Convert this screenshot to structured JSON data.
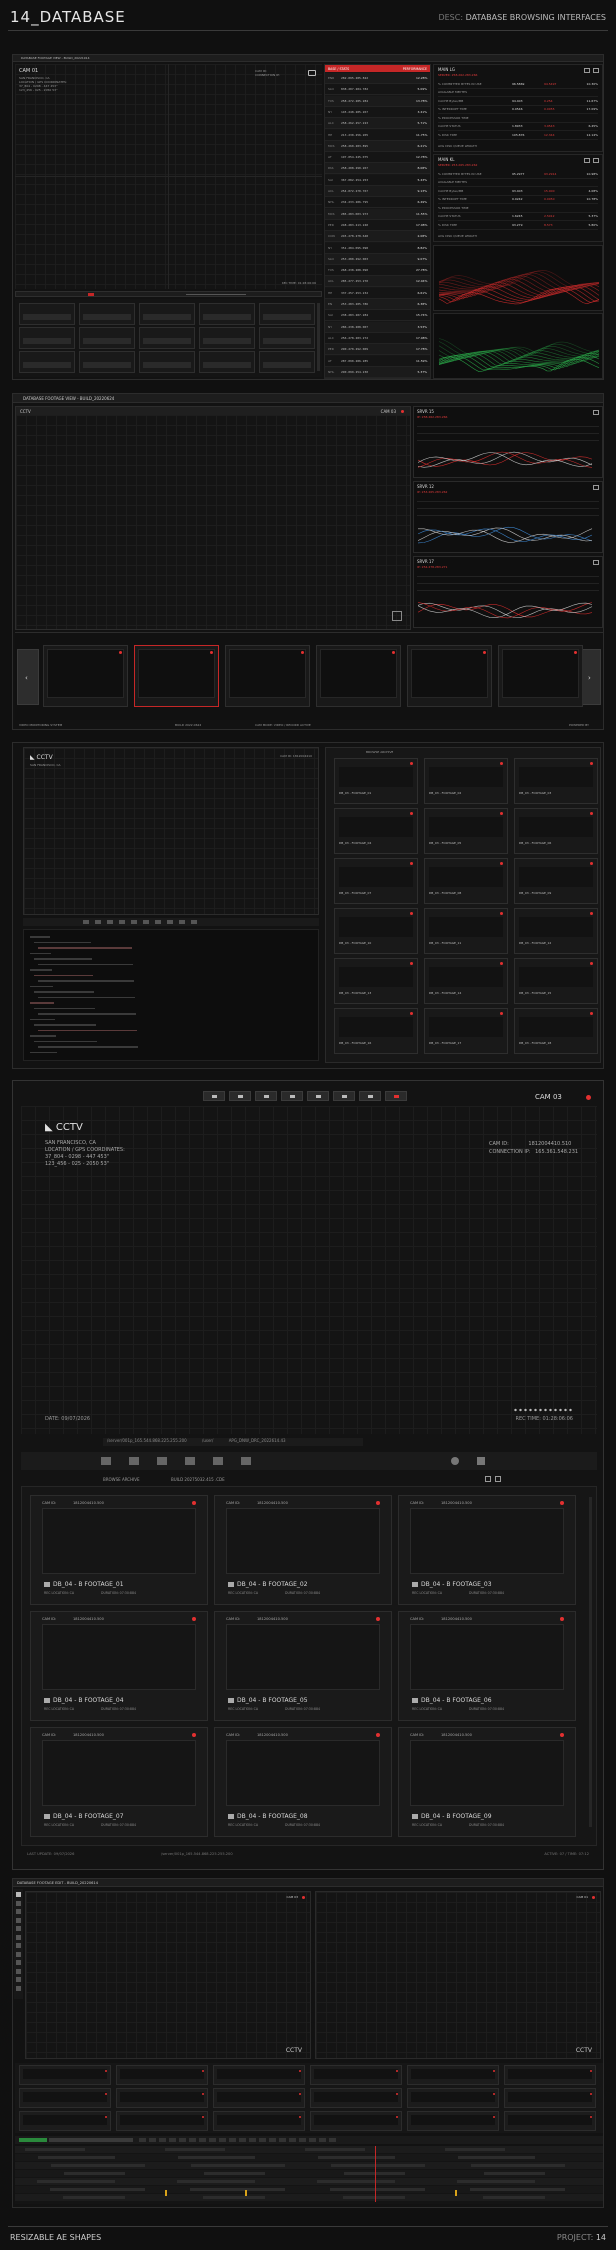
{
  "header": {
    "title": "14_DATABASE",
    "desc_label": "DESC:",
    "desc_value": "DATABASE BROWSING INTERFACES"
  },
  "footer": {
    "left": "RESIZABLE AE SHAPES",
    "right_label": "PROJECT:",
    "right_value": "14"
  },
  "section1": {
    "window_title": "DATABASE FOOTAGE VIEW - BUILD_20221914",
    "cam_label": "CAM 01",
    "loc_lines": [
      "SAN FRANCISCO, CA",
      "LOCATION / GPS COORDINATES:",
      "37_804 - 0298 - 447 453\"",
      "123_456 - 025 - 2050 53\""
    ],
    "info_right": [
      "CAM ID:",
      "CONNECTION IP:"
    ],
    "rec_time": "REC TIME: 01:28:06:06",
    "list_header": "BASE / STATS",
    "list_header_right": "PERFORMANCE",
    "rows": [
      {
        "tag": "ENR",
        "ip": "282.095.285.822",
        "pct": "12.28%"
      },
      {
        "tag": "SLO",
        "ip": "838.207.284.782",
        "pct": "5.09%"
      },
      {
        "tag": "TXS",
        "ip": "258.272.285.284",
        "pct": "13.78%"
      },
      {
        "tag": "NY",
        "ip": "145.248.285.267",
        "pct": "3.41%"
      },
      {
        "tag": "ALC",
        "ip": "258.262.257.223",
        "pct": "5.71%"
      },
      {
        "tag": "HE",
        "ip": "213.230.256.205",
        "pct": "11.75%"
      },
      {
        "tag": "MCS",
        "ip": "258.260.283.895",
        "pct": "6.21%"
      },
      {
        "tag": "AT",
        "ip": "197.054.245.075",
        "pct": "12.78%"
      },
      {
        "tag": "PAS",
        "ip": "258.208.290.267",
        "pct": "8.08%"
      },
      {
        "tag": "SAI",
        "ip": "367.082.254.253",
        "pct": "5.43%"
      },
      {
        "tag": "ACL",
        "ip": "254.072.270.767",
        "pct": "9.13%"
      },
      {
        "tag": "NHL",
        "ip": "234.233.286.795",
        "pct": "6.49%"
      },
      {
        "tag": "MCS",
        "ip": "285.283.003.973",
        "pct": "11.55%"
      },
      {
        "tag": "PER",
        "ip": "248.283.213.240",
        "pct": "17.08%"
      },
      {
        "tag": "CON",
        "ip": "245.278.278.648",
        "pct": "2.08%"
      },
      {
        "tag": "NY",
        "ip": "351.284.095.098",
        "pct": "8.82%"
      },
      {
        "tag": "SLO",
        "ip": "253.280.292.003",
        "pct": "9.07%"
      },
      {
        "tag": "TXS",
        "ip": "268.238.288.090",
        "pct": "27.78%"
      },
      {
        "tag": "ACL",
        "ip": "285.277.253.270",
        "pct": "12.04%"
      },
      {
        "tag": "HE",
        "ip": "337.257.253.232",
        "pct": "6.61%"
      },
      {
        "tag": "EN",
        "ip": "253.283.285.786",
        "pct": "6.38%"
      },
      {
        "tag": "SAI",
        "ip": "238.283.287.284",
        "pct": "15.74%"
      },
      {
        "tag": "NY",
        "ip": "286.238.288.007",
        "pct": "3.53%"
      },
      {
        "tag": "ALC",
        "ip": "256.278.283.272",
        "pct": "17.08%"
      },
      {
        "tag": "PER",
        "ip": "290.270.292.009",
        "pct": "17.78%"
      },
      {
        "tag": "AT",
        "ip": "287.090.286.285",
        "pct": "11.59%"
      },
      {
        "tag": "NHL",
        "ip": "290.099.254.230",
        "pct": "5.37%"
      }
    ],
    "stats_a": {
      "title": "MAIN LG",
      "subtitle": "SERVER: 258.262.283.266",
      "lines": [
        {
          "k": "% COMMITTED BYTES IN USE",
          "a": "96.5869",
          "b": "94.5497",
          "c": "10.30%"
        },
        {
          "k": "AVAILABLE MBYTES",
          "a": "",
          "b": "",
          "c": ""
        },
        {
          "k": "CACHE Bytes/MB",
          "a": "94.403",
          "b": "0.254",
          "c": "11.67%"
        },
        {
          "k": "% INTERRUPT TIME",
          "a": "0.0546",
          "b": "0.0055",
          "c": "17.09%"
        },
        {
          "k": "% PROCESSOR TIME",
          "a": "",
          "b": "",
          "c": ""
        },
        {
          "k": "CACHE STATUS",
          "a": "1.8933",
          "b": "3.9543",
          "c": "6.45%"
        },
        {
          "k": "% DISK TIME",
          "a": "105.876",
          "b": "12.344",
          "c": "12.14%"
        }
      ],
      "footer": "AVG DISK QUEUE LENGTH"
    },
    "stats_b": {
      "title": "MAIN KL",
      "subtitle": "SERVER: 253.265.283.262",
      "lines": [
        {
          "k": "% COMMITTED BYTES IN USE",
          "a": "95.2977",
          "b": "93.2914",
          "c": "10.98%"
        },
        {
          "k": "AVAILABLE MBYTES",
          "a": "",
          "b": "",
          "c": ""
        },
        {
          "k": "CACHE Bytes/MB",
          "a": "93.403",
          "b": "15.000",
          "c": "4.08%"
        },
        {
          "k": "% INTERRUPT TIME",
          "a": "0.0242",
          "b": "0.0050",
          "c": "10.78%"
        },
        {
          "k": "% PROCESSOR TIME",
          "a": "",
          "b": "",
          "c": ""
        },
        {
          "k": "CACHE STATUS",
          "a": "1.6245",
          "b": "2.5012",
          "c": "5.37%"
        },
        {
          "k": "% DISK TIME",
          "a": "93.279",
          "b": "8.573",
          "c": "5.80%"
        }
      ],
      "footer": "AVG DISK QUEUE LENGTH"
    }
  },
  "section2": {
    "window_title": "DATABASE FOOTAGE VIEW - BUILD_20220624",
    "cctv_label": "CCTV",
    "cam_label": "CAM 03",
    "servers": [
      {
        "title": "SRVR 15",
        "sub": "IP: 258.262.283.266"
      },
      {
        "title": "SRVR 12",
        "sub": "IP: 253.265.283.262"
      },
      {
        "title": "SRVR 17",
        "sub": "IP: 254.278.283.271"
      }
    ],
    "footer_items": [
      "VIDEO MONITORING SYSTEM",
      "BUILD 2022.0624",
      "CAM MODE: VIDEO / RECORD ACTIVE",
      "POWERED BY"
    ]
  },
  "section3": {
    "cctv_label": "CCTV",
    "loc": "SAN FRANCISCO, CA",
    "cam_id": "CAM ID: 1812004410",
    "browse_label": "BROWSE ARCHIVE",
    "tiles": [
      "DB_03 - FOOTAGE_01",
      "DB_03 - FOOTAGE_02",
      "DB_03 - FOOTAGE_03",
      "DB_03 - FOOTAGE_04",
      "DB_03 - FOOTAGE_05",
      "DB_03 - FOOTAGE_06",
      "DB_03 - FOOTAGE_07",
      "DB_03 - FOOTAGE_08",
      "DB_03 - FOOTAGE_09",
      "DB_03 - FOOTAGE_10",
      "DB_03 - FOOTAGE_11",
      "DB_03 - FOOTAGE_12",
      "DB_03 - FOOTAGE_13",
      "DB_03 - FOOTAGE_14",
      "DB_03 - FOOTAGE_15",
      "DB_03 - FOOTAGE_16",
      "DB_03 - FOOTAGE_17",
      "DB_03 - FOOTAGE_18"
    ]
  },
  "section4": {
    "cctv_label": "CCTV",
    "cam_label": "CAM 03",
    "city": "SAN FRANCISCO, CA",
    "gps_label": "LOCATION / GPS COORDINATES:",
    "gps_1": "37_804 - 0298 - 447 453\"",
    "gps_2": "123_456 - 025 - 2050 53\"",
    "cam_id_label": "CAM ID:",
    "cam_id_value": "1812004410.510",
    "conn_label": "CONNECTION IP:",
    "conn_value": "165.361.548.231",
    "date": "DATE: 09/07/2026",
    "rec_time": "REC TIME: 01:28:06:06",
    "path_1": "/server/001p_165.544.868.225.255.200",
    "path_2": "/user/",
    "path_3": "APG_DNW_DRC_2022614.43",
    "browse_label": "BROWSE ARCHIVE",
    "build_label": "BUILD 20275032.415 .CDE",
    "cards": [
      {
        "cam": "CAM ID:",
        "id": "1812004410.500",
        "title": "DB_04 - B FOOTAGE_01",
        "loc": "REC LOCATION: CA",
        "dur": "DURATION: 07:30:884"
      },
      {
        "cam": "CAM ID:",
        "id": "1812004410.500",
        "title": "DB_04 - B FOOTAGE_02",
        "loc": "REC LOCATION: CA",
        "dur": "DURATION: 07:30:884"
      },
      {
        "cam": "CAM ID:",
        "id": "1812004410.500",
        "title": "DB_04 - B FOOTAGE_03",
        "loc": "REC LOCATION: CA",
        "dur": "DURATION: 07:30:884"
      },
      {
        "cam": "CAM ID:",
        "id": "1812004410.500",
        "title": "DB_04 - B FOOTAGE_04",
        "loc": "REC LOCATION: CA",
        "dur": "DURATION: 07:30:884"
      },
      {
        "cam": "CAM ID:",
        "id": "1812004410.500",
        "title": "DB_04 - B FOOTAGE_05",
        "loc": "REC LOCATION: CA",
        "dur": "DURATION: 07:30:884"
      },
      {
        "cam": "CAM ID:",
        "id": "1812004410.500",
        "title": "DB_04 - B FOOTAGE_06",
        "loc": "REC LOCATION: CA",
        "dur": "DURATION: 07:30:884"
      },
      {
        "cam": "CAM ID:",
        "id": "1812004410.500",
        "title": "DB_04 - B FOOTAGE_07",
        "loc": "REC LOCATION: CA",
        "dur": "DURATION: 07:30:884"
      },
      {
        "cam": "CAM ID:",
        "id": "1812004410.500",
        "title": "DB_04 - B FOOTAGE_08",
        "loc": "REC LOCATION: CA",
        "dur": "DURATION: 07:30:884"
      },
      {
        "cam": "CAM ID:",
        "id": "1812004410.500",
        "title": "DB_04 - B FOOTAGE_09",
        "loc": "REC LOCATION: CA",
        "dur": "DURATION: 07:30:884"
      }
    ],
    "bottom_left": "LAST UPDATE: 09/07/2026",
    "bottom_mid": "/server/001p_165.544.868.225.255.200",
    "bottom_right": "ACTIVE: 07 / TIME: 07:12"
  },
  "section5": {
    "window_title": "DATABASE FOOTAGE EDIT - BUILD_20220614",
    "cam_left": "CAM 03",
    "cam_right": "CAM 01",
    "cctv_label": "CCTV"
  },
  "colors": {
    "accent_red": "#e23b3b",
    "chart_red": "#c42a2a",
    "chart_green": "#2aa447",
    "chart_blue": "#3a7fc4",
    "bg": "#101010"
  }
}
